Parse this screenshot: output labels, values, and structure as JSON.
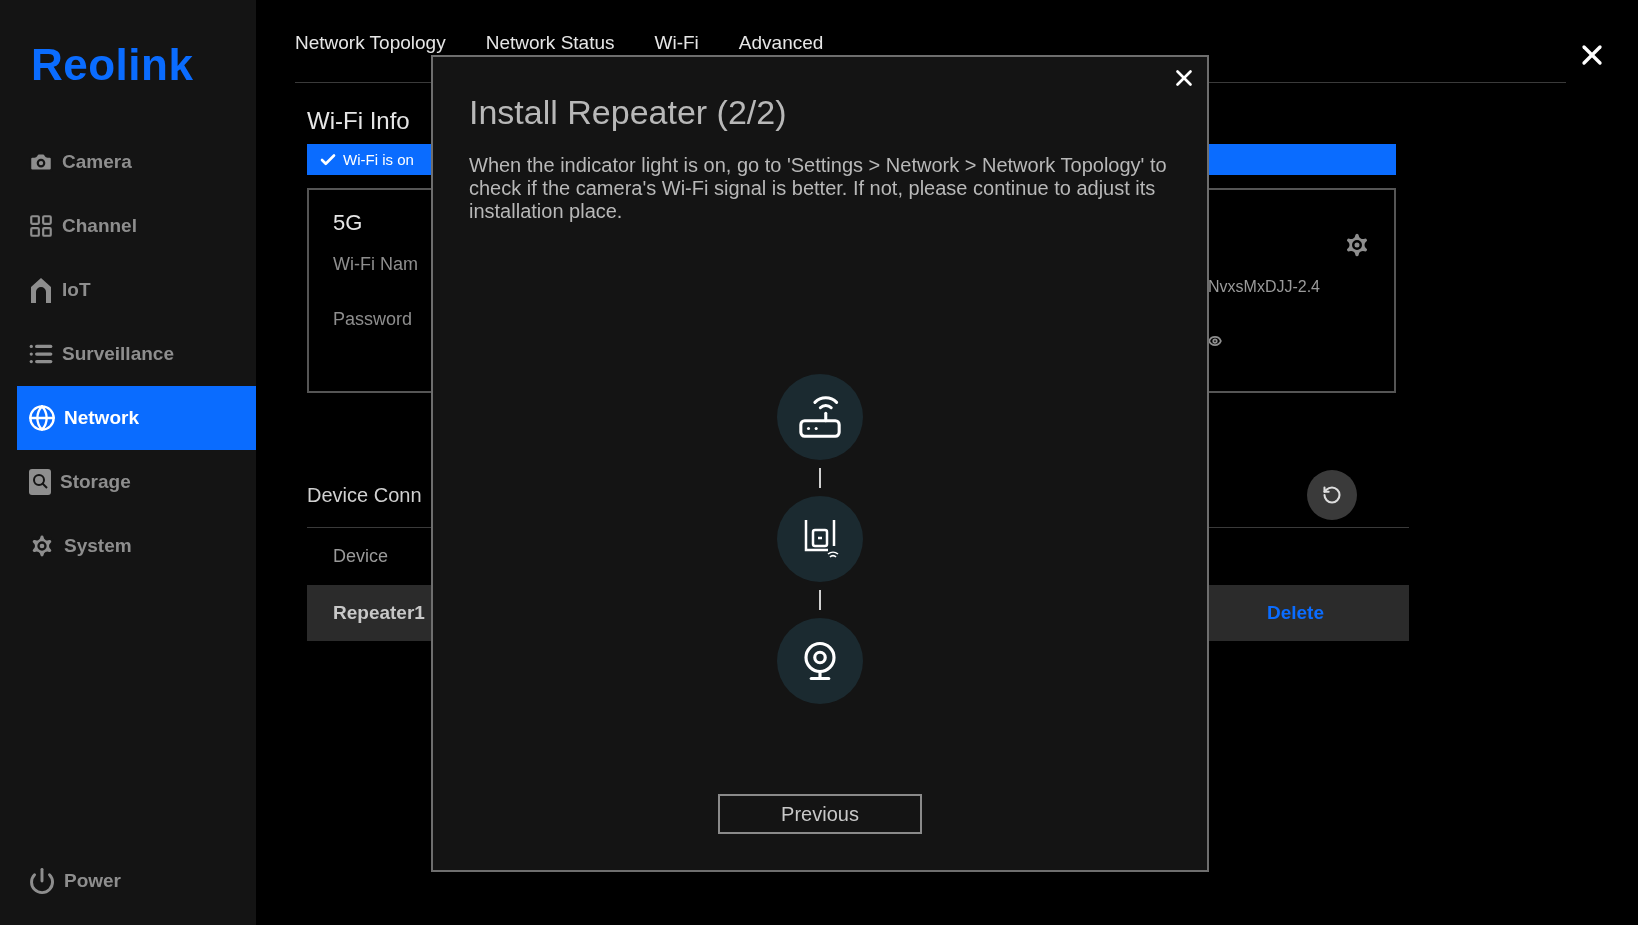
{
  "sidebar": {
    "logo": "Reolink",
    "items": [
      {
        "label": "Camera",
        "kind": "camera",
        "selected": false
      },
      {
        "label": "Channel",
        "kind": "channel",
        "selected": false
      },
      {
        "label": "IoT",
        "kind": "iot",
        "selected": false
      },
      {
        "label": "Surveillance",
        "kind": "surveillance",
        "selected": false
      },
      {
        "label": "Network",
        "kind": "network",
        "selected": true
      },
      {
        "label": "Storage",
        "kind": "storage",
        "selected": false
      },
      {
        "label": "System",
        "kind": "system",
        "selected": false
      }
    ],
    "power": "Power"
  },
  "tabs": [
    {
      "label": "Network Topology"
    },
    {
      "label": "Network Status"
    },
    {
      "label": "Wi-Fi"
    },
    {
      "label": "Advanced"
    }
  ],
  "wifi_info": {
    "title": "Wi-Fi Info",
    "toggle": {
      "label": "Wi-Fi is on",
      "checked": true
    },
    "band": "5G",
    "name_label": "Wi-Fi Nam",
    "password_label": "Password",
    "name_value": "NvxsMxDJJ-2.4"
  },
  "devices": {
    "title": "Device Conn",
    "column_1": "Device",
    "rows": [
      {
        "device": "Repeater1",
        "action": "Delete"
      }
    ]
  },
  "dialog": {
    "title": "Install Repeater (2/2)",
    "text": "When the indicator light is on,  go to 'Settings > Network > Network Topology' to check if the camera's Wi-Fi signal is better. If not, please continue to adjust its installation place.",
    "steps": [
      {
        "kind": "router"
      },
      {
        "kind": "repeater"
      },
      {
        "kind": "camera"
      }
    ],
    "button": "Previous"
  }
}
